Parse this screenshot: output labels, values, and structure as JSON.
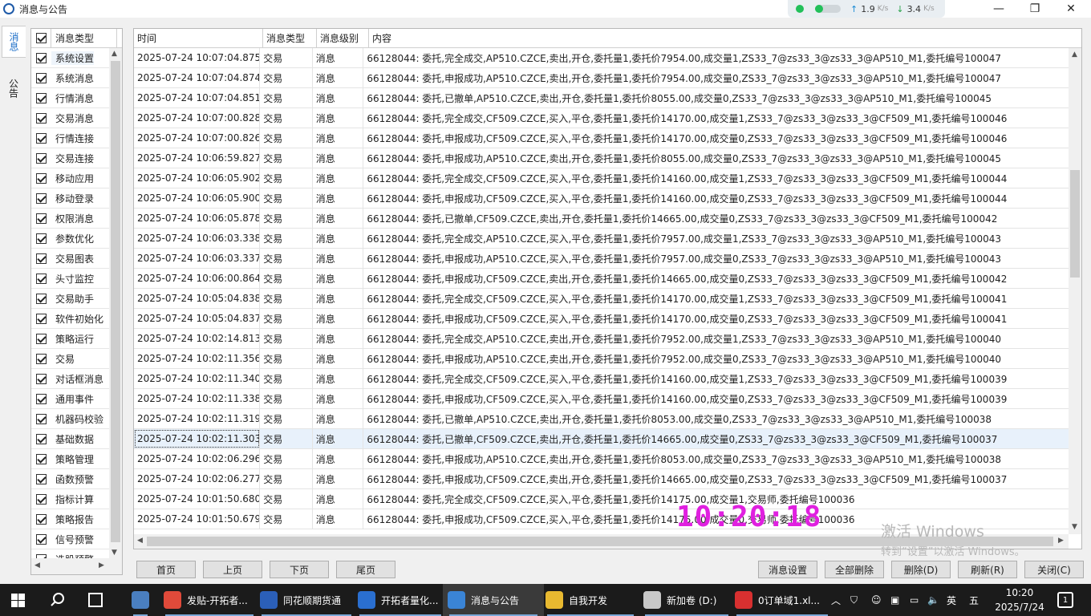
{
  "window": {
    "title": "消息与公告",
    "minimize": "—",
    "maximize": "❐",
    "close": "✕"
  },
  "speed_widget": {
    "upload": "1.9",
    "download": "3.4",
    "unit": "K/s",
    "upload_arrow": "↑",
    "download_arrow": "↓"
  },
  "side_tabs": [
    {
      "label": "消息",
      "active": true
    },
    {
      "label": "公告",
      "active": false
    }
  ],
  "type_panel": {
    "header": "消息类型",
    "items": [
      {
        "label": "系统设置",
        "checked": true
      },
      {
        "label": "系统消息",
        "checked": true
      },
      {
        "label": "行情消息",
        "checked": true
      },
      {
        "label": "交易消息",
        "checked": true
      },
      {
        "label": "行情连接",
        "checked": true
      },
      {
        "label": "交易连接",
        "checked": true
      },
      {
        "label": "移动应用",
        "checked": true
      },
      {
        "label": "移动登录",
        "checked": true
      },
      {
        "label": "权限消息",
        "checked": true
      },
      {
        "label": "参数优化",
        "checked": true
      },
      {
        "label": "交易图表",
        "checked": true
      },
      {
        "label": "头寸监控",
        "checked": true
      },
      {
        "label": "交易助手",
        "checked": true
      },
      {
        "label": "软件初始化",
        "checked": true
      },
      {
        "label": "策略运行",
        "checked": true
      },
      {
        "label": "交易",
        "checked": true
      },
      {
        "label": "对话框消息",
        "checked": true
      },
      {
        "label": "通用事件",
        "checked": true
      },
      {
        "label": "机器码校验",
        "checked": true
      },
      {
        "label": "基础数据",
        "checked": true
      },
      {
        "label": "策略管理",
        "checked": true
      },
      {
        "label": "函数预警",
        "checked": true
      },
      {
        "label": "指标计算",
        "checked": true
      },
      {
        "label": "策略报告",
        "checked": true
      },
      {
        "label": "信号预警",
        "checked": true
      },
      {
        "label": "选股预警",
        "checked": true
      }
    ]
  },
  "grid": {
    "columns": {
      "time": "时间",
      "type": "消息类型",
      "level": "消息级别",
      "content": "内容"
    },
    "rows": [
      {
        "time": "2025-07-24 10:07:04.875",
        "type": "交易",
        "level": "消息",
        "content": "66128044: 委托,完全成交,AP510.CZCE,卖出,开仓,委托量1,委托价7954.00,成交量1,ZS33_7@zs33_3@zs33_3@AP510_M1,委托编号100047"
      },
      {
        "time": "2025-07-24 10:07:04.874",
        "type": "交易",
        "level": "消息",
        "content": "66128044: 委托,申报成功,AP510.CZCE,卖出,开仓,委托量1,委托价7954.00,成交量0,ZS33_7@zs33_3@zs33_3@AP510_M1,委托编号100047"
      },
      {
        "time": "2025-07-24 10:07:04.851",
        "type": "交易",
        "level": "消息",
        "content": "66128044: 委托,已撤单,AP510.CZCE,卖出,开仓,委托量1,委托价8055.00,成交量0,ZS33_7@zs33_3@zs33_3@AP510_M1,委托编号100045"
      },
      {
        "time": "2025-07-24 10:07:00.828",
        "type": "交易",
        "level": "消息",
        "content": "66128044: 委托,完全成交,CF509.CZCE,买入,平仓,委托量1,委托价14170.00,成交量1,ZS33_7@zs33_3@zs33_3@CF509_M1,委托编号100046"
      },
      {
        "time": "2025-07-24 10:07:00.826",
        "type": "交易",
        "level": "消息",
        "content": "66128044: 委托,申报成功,CF509.CZCE,买入,平仓,委托量1,委托价14170.00,成交量0,ZS33_7@zs33_3@zs33_3@CF509_M1,委托编号100046"
      },
      {
        "time": "2025-07-24 10:06:59.827",
        "type": "交易",
        "level": "消息",
        "content": "66128044: 委托,申报成功,AP510.CZCE,卖出,开仓,委托量1,委托价8055.00,成交量0,ZS33_7@zs33_3@zs33_3@AP510_M1,委托编号100045"
      },
      {
        "time": "2025-07-24 10:06:05.902",
        "type": "交易",
        "level": "消息",
        "content": "66128044: 委托,完全成交,CF509.CZCE,买入,平仓,委托量1,委托价14160.00,成交量1,ZS33_7@zs33_3@zs33_3@CF509_M1,委托编号100044"
      },
      {
        "time": "2025-07-24 10:06:05.900",
        "type": "交易",
        "level": "消息",
        "content": "66128044: 委托,申报成功,CF509.CZCE,买入,平仓,委托量1,委托价14160.00,成交量0,ZS33_7@zs33_3@zs33_3@CF509_M1,委托编号100044"
      },
      {
        "time": "2025-07-24 10:06:05.878",
        "type": "交易",
        "level": "消息",
        "content": "66128044: 委托,已撤单,CF509.CZCE,卖出,开仓,委托量1,委托价14665.00,成交量0,ZS33_7@zs33_3@zs33_3@CF509_M1,委托编号100042"
      },
      {
        "time": "2025-07-24 10:06:03.338",
        "type": "交易",
        "level": "消息",
        "content": "66128044: 委托,完全成交,AP510.CZCE,买入,平仓,委托量1,委托价7957.00,成交量1,ZS33_7@zs33_3@zs33_3@AP510_M1,委托编号100043"
      },
      {
        "time": "2025-07-24 10:06:03.337",
        "type": "交易",
        "level": "消息",
        "content": "66128044: 委托,申报成功,AP510.CZCE,买入,平仓,委托量1,委托价7957.00,成交量0,ZS33_7@zs33_3@zs33_3@AP510_M1,委托编号100043"
      },
      {
        "time": "2025-07-24 10:06:00.864",
        "type": "交易",
        "level": "消息",
        "content": "66128044: 委托,申报成功,CF509.CZCE,卖出,开仓,委托量1,委托价14665.00,成交量0,ZS33_7@zs33_3@zs33_3@CF509_M1,委托编号100042"
      },
      {
        "time": "2025-07-24 10:05:04.838",
        "type": "交易",
        "level": "消息",
        "content": "66128044: 委托,完全成交,CF509.CZCE,买入,平仓,委托量1,委托价14170.00,成交量1,ZS33_7@zs33_3@zs33_3@CF509_M1,委托编号100041"
      },
      {
        "time": "2025-07-24 10:05:04.837",
        "type": "交易",
        "level": "消息",
        "content": "66128044: 委托,申报成功,CF509.CZCE,买入,平仓,委托量1,委托价14170.00,成交量0,ZS33_7@zs33_3@zs33_3@CF509_M1,委托编号100041"
      },
      {
        "time": "2025-07-24 10:02:14.813",
        "type": "交易",
        "level": "消息",
        "content": "66128044: 委托,完全成交,AP510.CZCE,卖出,开仓,委托量1,委托价7952.00,成交量1,ZS33_7@zs33_3@zs33_3@AP510_M1,委托编号100040"
      },
      {
        "time": "2025-07-24 10:02:11.356",
        "type": "交易",
        "level": "消息",
        "content": "66128044: 委托,申报成功,AP510.CZCE,卖出,开仓,委托量1,委托价7952.00,成交量0,ZS33_7@zs33_3@zs33_3@AP510_M1,委托编号100040"
      },
      {
        "time": "2025-07-24 10:02:11.340",
        "type": "交易",
        "level": "消息",
        "content": "66128044: 委托,完全成交,CF509.CZCE,买入,平仓,委托量1,委托价14160.00,成交量1,ZS33_7@zs33_3@zs33_3@CF509_M1,委托编号100039"
      },
      {
        "time": "2025-07-24 10:02:11.338",
        "type": "交易",
        "level": "消息",
        "content": "66128044: 委托,申报成功,CF509.CZCE,买入,平仓,委托量1,委托价14160.00,成交量0,ZS33_7@zs33_3@zs33_3@CF509_M1,委托编号100039"
      },
      {
        "time": "2025-07-24 10:02:11.319",
        "type": "交易",
        "level": "消息",
        "content": "66128044: 委托,已撤单,AP510.CZCE,卖出,开仓,委托量1,委托价8053.00,成交量0,ZS33_7@zs33_3@zs33_3@AP510_M1,委托编号100038"
      },
      {
        "time": "2025-07-24 10:02:11.303",
        "type": "交易",
        "level": "消息",
        "content": "66128044: 委托,已撤单,CF509.CZCE,卖出,开仓,委托量1,委托价14665.00,成交量0,ZS33_7@zs33_3@zs33_3@CF509_M1,委托编号100037",
        "selected": true
      },
      {
        "time": "2025-07-24 10:02:06.296",
        "type": "交易",
        "level": "消息",
        "content": "66128044: 委托,申报成功,AP510.CZCE,卖出,开仓,委托量1,委托价8053.00,成交量0,ZS33_7@zs33_3@zs33_3@AP510_M1,委托编号100038"
      },
      {
        "time": "2025-07-24 10:02:06.277",
        "type": "交易",
        "level": "消息",
        "content": "66128044: 委托,申报成功,CF509.CZCE,卖出,开仓,委托量1,委托价14665.00,成交量0,ZS33_7@zs33_3@zs33_3@CF509_M1,委托编号100037"
      },
      {
        "time": "2025-07-24 10:01:50.680",
        "type": "交易",
        "level": "消息",
        "content": "66128044: 委托,完全成交,CF509.CZCE,买入,平仓,委托量1,委托价14175.00,成交量1,交易师,委托编号100036"
      },
      {
        "time": "2025-07-24 10:01:50.679",
        "type": "交易",
        "level": "消息",
        "content": "66128044: 委托,申报成功,CF509.CZCE,买入,平仓,委托量1,委托价14175.00,成交量0,交易师,委托编号100036"
      }
    ]
  },
  "overlay_clock": "10:20:18",
  "activation": {
    "title": "激活 Windows",
    "subtitle": "转到“设置”以激活 Windows。"
  },
  "buttons": {
    "first": "首页",
    "prev": "上页",
    "next": "下页",
    "last": "尾页",
    "settings": "消息设置",
    "delete_all": "全部删除",
    "delete": "删除(D)",
    "refresh": "刷新(R)",
    "close": "关闭(C)"
  },
  "taskbar": {
    "apps": [
      {
        "label": "",
        "color": "#4a7fc0"
      },
      {
        "label": "发贴-开拓者...",
        "color": "#e04a3a"
      },
      {
        "label": "同花顺期货通",
        "color": "#2b5fb8"
      },
      {
        "label": "开拓者量化...",
        "color": "#2a6fd0"
      },
      {
        "label": "消息与公告",
        "color": "#3a84d6"
      },
      {
        "label": "自我开发",
        "color": "#e8b930"
      },
      {
        "label": "新加卷 (D:)",
        "color": "#c8c8c8"
      },
      {
        "label": "0订单域1.xl...",
        "color": "#d83030"
      }
    ],
    "ime": "英",
    "ime2": "五",
    "time": "10:20",
    "date": "2025/7/24",
    "notifications": "1"
  }
}
